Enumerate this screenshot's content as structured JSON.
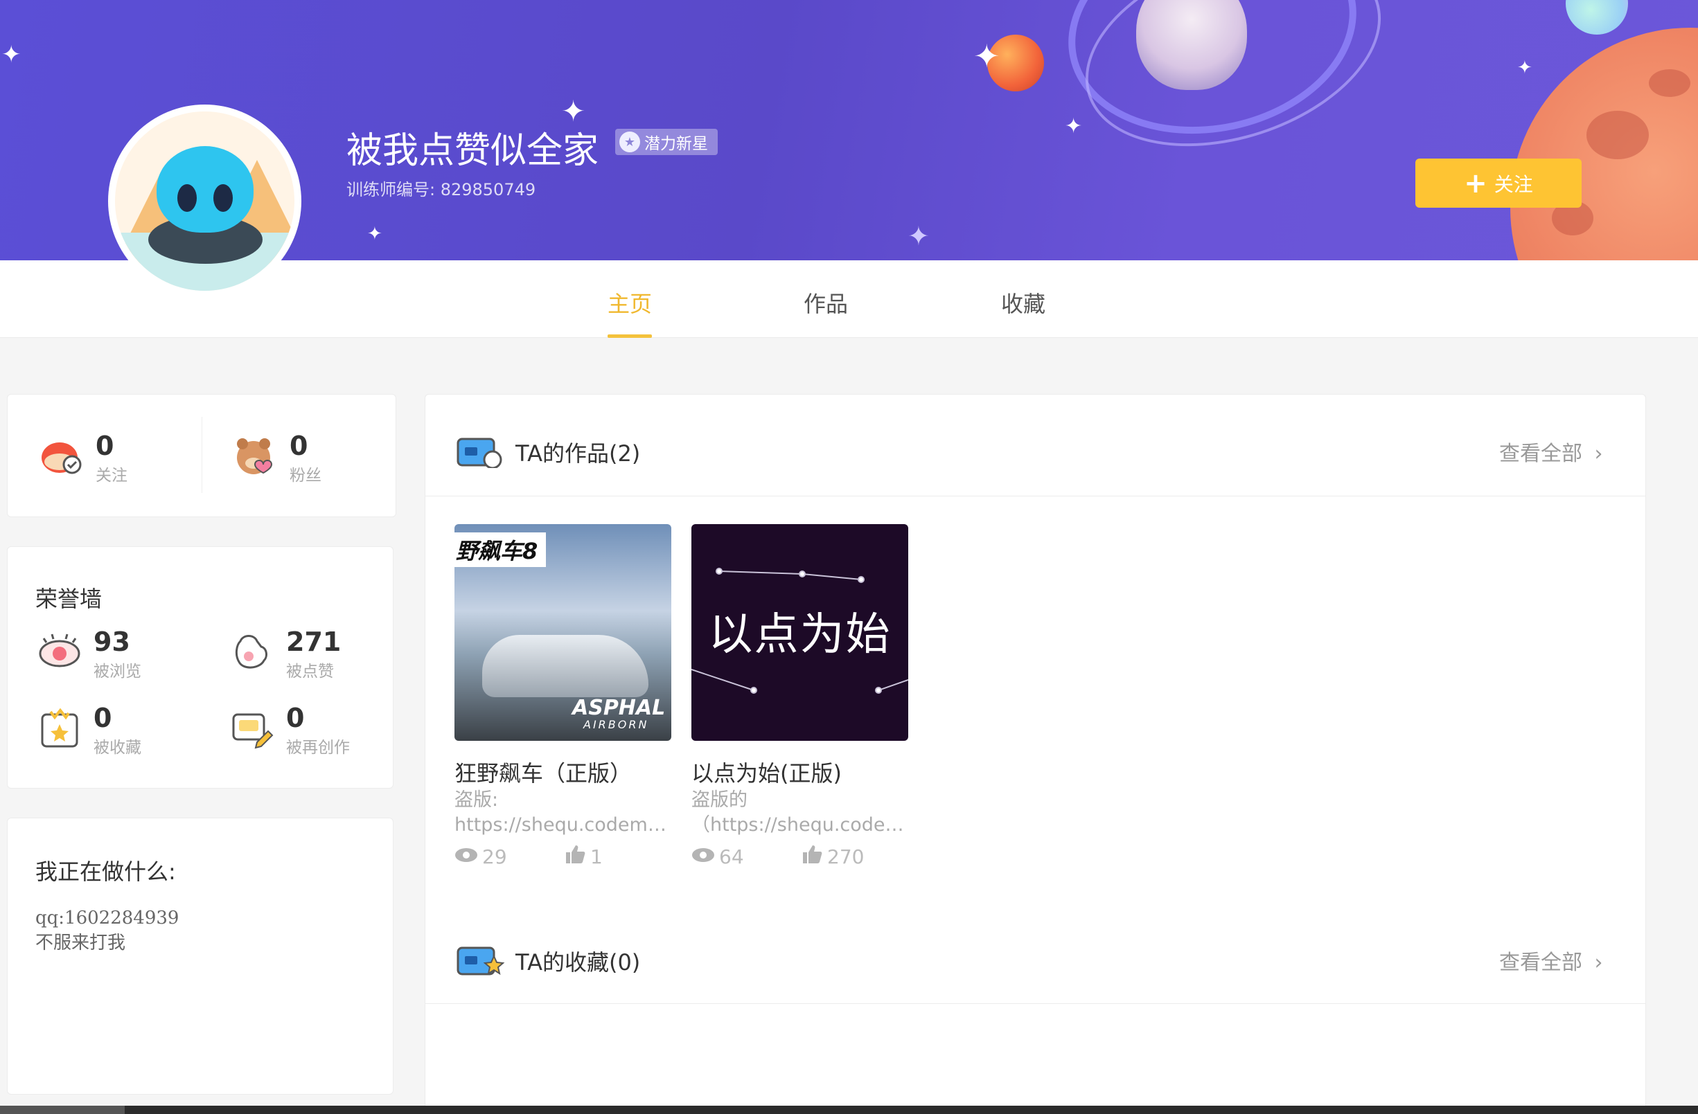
{
  "profile": {
    "username": "被我点赞似全家",
    "badge": "潜力新星",
    "trainer_id": "训练师编号: 829850749",
    "follow_label": "关注"
  },
  "tabs": [
    {
      "label": "主页",
      "active": true
    },
    {
      "label": "作品",
      "active": false
    },
    {
      "label": "收藏",
      "active": false
    }
  ],
  "social": {
    "following": {
      "value": "0",
      "label": "关注"
    },
    "fans": {
      "value": "0",
      "label": "粉丝"
    }
  },
  "honor": {
    "title": "荣誉墙",
    "views": {
      "value": "93",
      "label": "被浏览"
    },
    "likes": {
      "value": "271",
      "label": "被点赞"
    },
    "collected": {
      "value": "0",
      "label": "被收藏"
    },
    "remixed": {
      "value": "0",
      "label": "被再创作"
    }
  },
  "doing": {
    "title": "我正在做什么:",
    "line1": "qq:1602284939",
    "line2": "不服来打我"
  },
  "works_section": {
    "title": "TA的作品(2)",
    "see_all": "查看全部",
    "items": [
      {
        "title": "狂野飙车（正版）",
        "desc1": "盗版:",
        "desc2": "https://shequ.codema...",
        "views": "29",
        "likes": "1",
        "thumb_label": "野飙车8",
        "thumb_brand": "ASPHAL",
        "thumb_sub": "AIRBORN"
      },
      {
        "title": "以点为始(正版)",
        "desc1": "盗版的",
        "desc2": "（https://shequ.codem...",
        "views": "64",
        "likes": "270",
        "thumb_text": "以点为始"
      }
    ]
  },
  "collect_section": {
    "title": "TA的收藏(0)",
    "see_all": "查看全部"
  },
  "colors": {
    "accent": "#fec433",
    "tab_active": "#f0b82f",
    "banner": "#5b4fd6"
  }
}
